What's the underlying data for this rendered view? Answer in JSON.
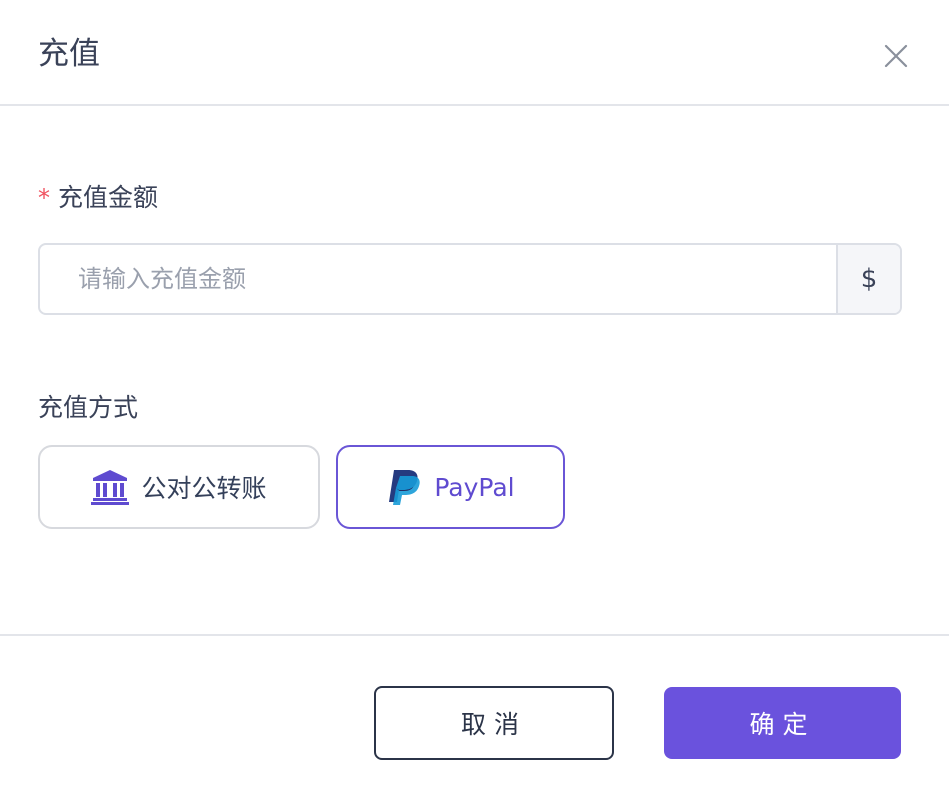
{
  "dialog": {
    "title": "充值",
    "close_icon": "close-icon"
  },
  "form": {
    "amount": {
      "label": "充值金额",
      "required_mark": "*",
      "placeholder": "请输入充值金额",
      "value": "",
      "currency_symbol": "$"
    },
    "method": {
      "label": "充值方式",
      "options": [
        {
          "label": "公对公转账",
          "icon": "bank-icon",
          "selected": false
        },
        {
          "label": "PayPal",
          "icon": "paypal-icon",
          "selected": true
        }
      ]
    }
  },
  "footer": {
    "cancel_label": "取消",
    "confirm_label": "确定"
  },
  "colors": {
    "accent": "#6a52dd",
    "required": "#f0525f",
    "text": "#3a4258",
    "border": "#dcdfe6"
  }
}
